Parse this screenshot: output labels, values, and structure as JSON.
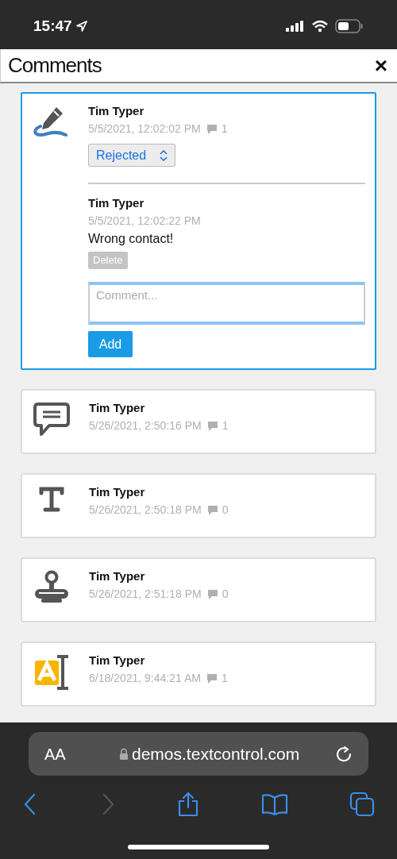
{
  "status_bar": {
    "time": "15:47"
  },
  "panel": {
    "title": "Comments",
    "close": "×"
  },
  "comments": [
    {
      "kind": "pen",
      "selected": true,
      "author": "Tim Typer",
      "date": "5/5/2021, 12:02:02 PM",
      "reply_count": "1",
      "status": "Rejected",
      "replies": [
        {
          "author": "Tim Typer",
          "date": "5/5/2021, 12:02:22 PM",
          "text": "Wrong contact!",
          "delete_label": "Delete"
        }
      ],
      "comment_placeholder": "Comment...",
      "add_label": "Add"
    },
    {
      "kind": "speech",
      "selected": false,
      "author": "Tim Typer",
      "date": "5/26/2021, 2:50:16 PM",
      "reply_count": "1"
    },
    {
      "kind": "text",
      "selected": false,
      "author": "Tim Typer",
      "date": "5/26/2021, 2:50:18 PM",
      "reply_count": "0"
    },
    {
      "kind": "stamp",
      "selected": false,
      "author": "Tim Typer",
      "date": "5/26/2021, 2:51:18 PM",
      "reply_count": "0"
    },
    {
      "kind": "field",
      "selected": false,
      "author": "Tim Typer",
      "date": "6/18/2021, 9:44:21 AM",
      "reply_count": "1"
    }
  ],
  "browser": {
    "text_size": "AA",
    "url": "demos.textcontrol.com"
  }
}
